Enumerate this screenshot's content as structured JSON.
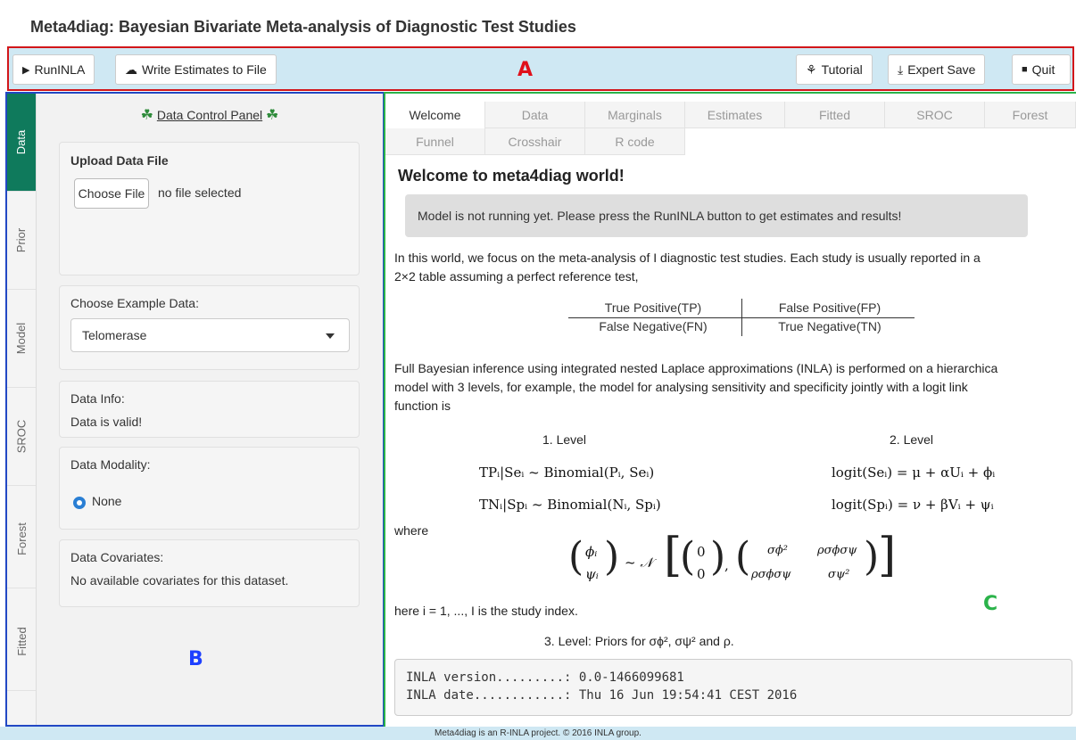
{
  "app_title": "Meta4diag: Bayesian Bivariate Meta-analysis of Diagnostic Test Studies",
  "toolbar": {
    "run_label": "RunINLA",
    "write_label": "Write Estimates to File",
    "tutorial_label": "Tutorial",
    "expert_save_label": "Expert Save",
    "quit_label": "Quit"
  },
  "region_labels": {
    "a": "A",
    "b": "B",
    "c": "C"
  },
  "side_tabs": [
    "Data",
    "Prior",
    "Model",
    "SROC",
    "Forest",
    "Fitted"
  ],
  "left_panel": {
    "title": "Data Control Panel",
    "upload_title": "Upload Data File",
    "choose_file_label": "Choose File",
    "no_file_text": "no file selected",
    "example_label": "Choose Example Data:",
    "example_selected": "Telomerase",
    "info_label": "Data Info:",
    "info_value": "Data is valid!",
    "modality_label": "Data Modality:",
    "modality_option": "None",
    "covariates_label": "Data Covariates:",
    "covariates_value": "No available covariates for this dataset."
  },
  "main_tabs_row1": [
    "Welcome",
    "Data",
    "Marginals",
    "Estimates",
    "Fitted",
    "SROC",
    "Forest"
  ],
  "main_tabs_row2": [
    "Funnel",
    "Crosshair",
    "R code"
  ],
  "welcome": {
    "heading": "Welcome to meta4diag world!",
    "alert": "Model is not running yet. Please press the RunINLA button to get estimates and results!",
    "intro_line1": "In this world, we focus on the meta-analysis of I diagnostic test studies. Each study is usually reported in a",
    "intro_line2": "2×2 table assuming a perfect reference test,",
    "table": {
      "tp": "True Positive(TP)",
      "fp": "False Positive(FP)",
      "fn": "False Negative(FN)",
      "tn": "True Negative(TN)"
    },
    "inla_line1": "Full Bayesian inference using integrated nested Laplace approximations (INLA) is performed on a hierarchica",
    "inla_line2": "model with 3 levels, for example, the model for analysing sensitivity and specificity jointly with a logit link",
    "inla_line3": "function is",
    "level1": "1. Level",
    "level2": "2. Level",
    "eq_tp": "TPᵢ|Seᵢ ~ Binomial(Pᵢ, Seᵢ)",
    "eq_tn": "TNᵢ|Spᵢ ~ Binomial(Nᵢ, Spᵢ)",
    "eq_se": "logit(Seᵢ) = μ + αUᵢ + ϕᵢ",
    "eq_sp": "logit(Spᵢ) = ν + βVᵢ + ψᵢ",
    "where": "where",
    "matrix": {
      "phi": "ϕᵢ",
      "psi": "ψᵢ",
      "normal": "~ 𝒩",
      "zero1": "0",
      "zero2": "0",
      "s_phi2": "σϕ²",
      "rho_sp1": "ρσϕσψ",
      "rho_sp2": "ρσϕσψ",
      "s_psi2": "σψ²"
    },
    "index_line": "here i = 1, ..., I is the study index.",
    "level3": "3. Level: Priors for σϕ², σψ² and ρ.",
    "inla_version": "INLA version.........: 0.0-1466099681",
    "inla_date": "INLA date............: Thu 16 Jun 19:54:41 CEST 2016"
  },
  "footer": "Meta4diag is an R-INLA project. © 2016 INLA group.",
  "colors": {
    "toolbar_bg": "#cfe8f3",
    "region_a": "#d2161a",
    "region_b": "#2248c4",
    "region_c": "#2bb34a",
    "active_tab": "#0f7a5c",
    "radio": "#2a7fd4"
  }
}
